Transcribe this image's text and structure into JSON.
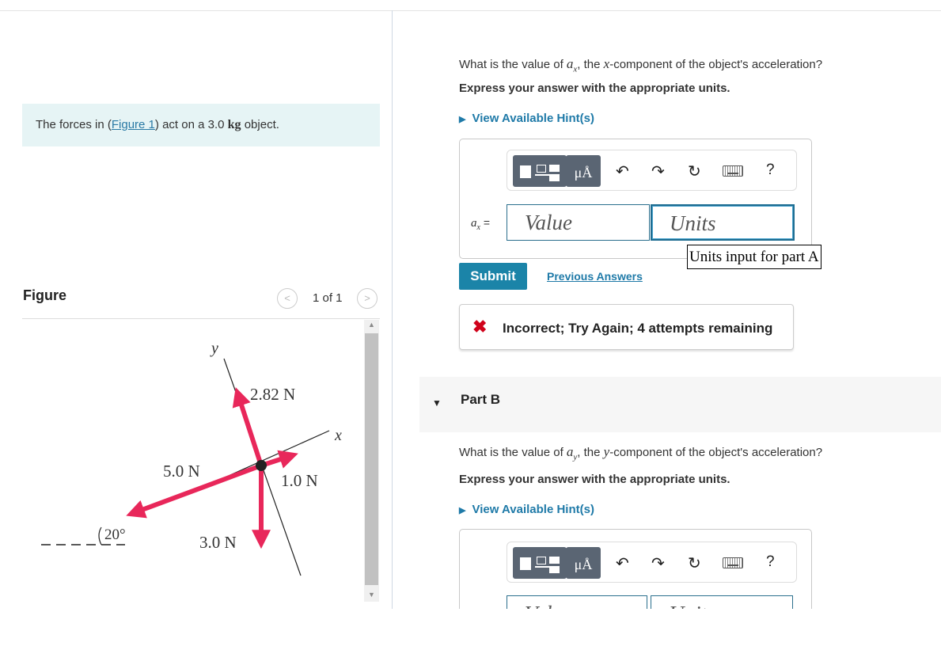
{
  "problem": {
    "text_before": "The forces in (",
    "figure_link": "Figure 1",
    "text_after": ") act on a 3.0 ",
    "unit": "kg",
    "text_end": " object."
  },
  "figure": {
    "title": "Figure",
    "pager": "1 of 1",
    "prev": "<",
    "next": ">",
    "labels": {
      "y": "y",
      "x": "x",
      "f1": "2.82 N",
      "f2": "5.0 N",
      "f3": "1.0 N",
      "f4": "3.0 N",
      "angle": "20°"
    },
    "colors": {
      "arrow": "#e8275a",
      "axis": "#222222"
    }
  },
  "partA": {
    "question_pre": "What is the value of ",
    "var_sym": "a",
    "var_sub": "x",
    "question_mid": ", the ",
    "comp": "x",
    "question_post": "-component of the object's acceleration?",
    "instruction": "Express your answer with the appropriate units.",
    "hint": "View Available Hint(s)",
    "var_label_sym": "a",
    "var_label_sub": "x",
    "equals": "=",
    "value_placeholder": "Value",
    "units_placeholder": "Units",
    "tooltip": "Units input for part A",
    "submit": "Submit",
    "previous_answers": "Previous Answers",
    "feedback": "Incorrect; Try Again; 4 attempts remaining",
    "feedback_icon": "✖"
  },
  "toolbar": {
    "mu": "μÅ",
    "undo": "↶",
    "redo": "↷",
    "reset": "↻",
    "help": "?"
  },
  "partB": {
    "label": "Part B",
    "question_pre": "What is the value of ",
    "var_sym": "a",
    "var_sub": "y",
    "question_mid": ", the ",
    "comp": "y",
    "question_post": "-component of the object's acceleration?",
    "instruction": "Express your answer with the appropriate units.",
    "hint": "View Available Hint(s)",
    "value_placeholder": "Value",
    "units_placeholder": "Units"
  },
  "colors": {
    "link": "#1f7aa8",
    "submit_bg": "#1b84a8",
    "error": "#d0021b",
    "prompt_bg": "#e6f4f5"
  }
}
